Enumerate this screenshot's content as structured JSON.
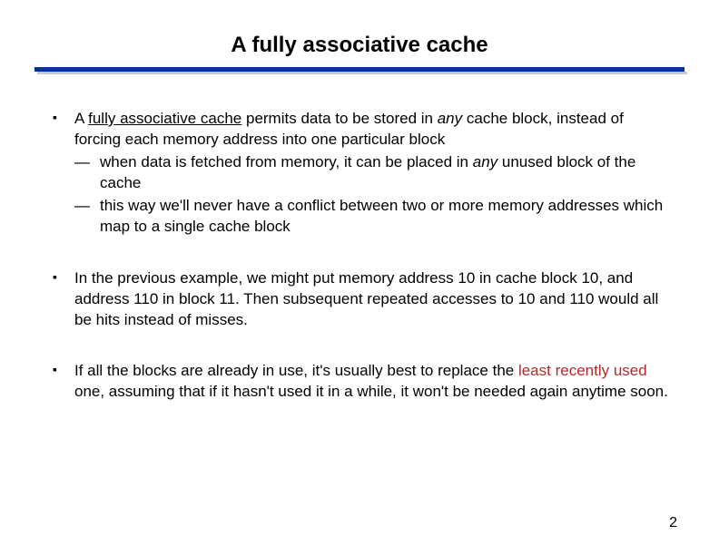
{
  "title": "A fully associative cache",
  "page_number": "2",
  "bullets": [
    {
      "runs": [
        {
          "text": "A ",
          "cls": ""
        },
        {
          "text": "fully associative cache",
          "cls": "u"
        },
        {
          "text": " permits data to be stored in ",
          "cls": ""
        },
        {
          "text": "any",
          "cls": "i"
        },
        {
          "text": " cache block, instead of forcing each memory address into one particular block",
          "cls": ""
        }
      ],
      "sub": [
        {
          "runs": [
            {
              "text": "when data is fetched from memory, it can be placed in ",
              "cls": ""
            },
            {
              "text": "any",
              "cls": "i"
            },
            {
              "text": " unused block of the cache",
              "cls": ""
            }
          ]
        },
        {
          "runs": [
            {
              "text": "this way we'll never have a conflict between two or more memory addresses which map to a single cache block",
              "cls": ""
            }
          ]
        }
      ]
    },
    {
      "runs": [
        {
          "text": "In the previous example, we might put memory address 10 in cache block 10, and address 110 in block 11. Then subsequent repeated accesses to 10 and 110 would all be hits instead of misses.",
          "cls": ""
        }
      ],
      "sub": []
    },
    {
      "runs": [
        {
          "text": "If all the blocks are already in use, it's usually best to replace the ",
          "cls": ""
        },
        {
          "text": "least recently used",
          "cls": "accent"
        },
        {
          "text": " one, assuming that if it hasn't used it in a while, it won't be needed again anytime soon.",
          "cls": ""
        }
      ],
      "sub": []
    }
  ]
}
